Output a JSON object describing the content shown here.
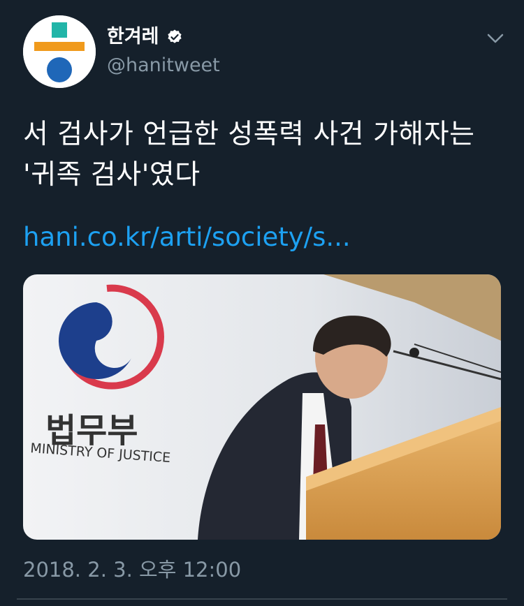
{
  "header": {
    "display_name": "한겨레",
    "handle": "@hanitweet",
    "avatar_icon": "hankyoreh-logo-icon",
    "verified_icon": "verified-badge-icon",
    "menu_icon": "chevron-down-icon"
  },
  "tweet": {
    "text_lines": [
      "서 검사가 언급한 성폭력 사건 가해자는",
      "'귀족 검사'였다"
    ],
    "link": "hani.co.kr/arti/society/s...",
    "timestamp": "2018. 2. 3. 오후 12:00",
    "media": {
      "sign_korean": "법무부",
      "sign_english": "MINISTRY OF JUSTICE"
    }
  },
  "colors": {
    "background": "#15202b",
    "link": "#1da1f2",
    "secondary_text": "#8899a6",
    "verified_badge": "#ffffff"
  }
}
